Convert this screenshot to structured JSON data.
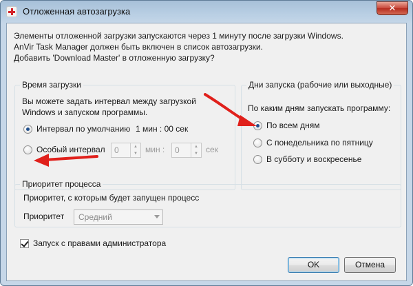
{
  "window": {
    "title": "Отложенная автозагрузка",
    "close_label": "✕"
  },
  "intro": {
    "line1": "Элементы отложенной загрузки запускаются через 1 минуту после загрузки Windows.",
    "line2": "AnVir Task Manager должен быть включен в список автозагрузки.",
    "line3": "Добавить 'Download Master' в отложенную загрузку?"
  },
  "load_time": {
    "legend": "Время загрузки",
    "description_line1": "Вы можете задать интервал между загрузкой",
    "description_line2": "Windows и запуском программы.",
    "option_default": "Интервал по умолчанию",
    "default_value": "1 мин : 00 сек",
    "option_custom": "Особый интервал",
    "minutes_value": "0",
    "minutes_unit": "мин :",
    "seconds_value": "0",
    "seconds_unit": "сек",
    "selected": "default"
  },
  "launch_days": {
    "legend": "Дни запуска (рабочие или выходные)",
    "question": "По каким дням запускать программу:",
    "options": [
      "По всем дням",
      "С понедельника по пятницу",
      "В субботу и воскресенье"
    ],
    "selected_index": 0
  },
  "priority": {
    "legend": "Приоритет процесса",
    "description": "Приоритет, с которым будет запущен процесс",
    "label": "Приоритет",
    "value": "Средний"
  },
  "admin_checkbox": {
    "label": "Запуск с правами администратора",
    "checked": true
  },
  "buttons": {
    "ok": "OK",
    "cancel": "Отмена"
  },
  "colors": {
    "annotation_arrow": "#e0201b",
    "radio_selected": "#1f4e8c"
  }
}
